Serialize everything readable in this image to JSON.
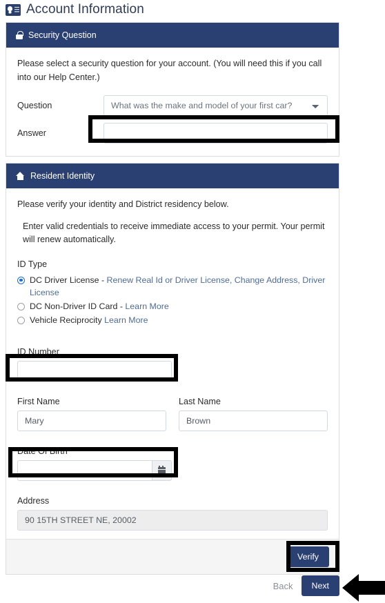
{
  "page": {
    "title": "Account Information",
    "title_icon": "id-card-icon"
  },
  "security_panel": {
    "icon": "lock-icon",
    "heading": "Security Question",
    "intro": "Please select a security question for your account. (You will need this if you call into our Help Center.)",
    "question_label": "Question",
    "question_value": "What was the make and model of your first car?",
    "question_options": [
      "What was the make and model of your first car?"
    ],
    "answer_label": "Answer",
    "answer_value": "",
    "answer_placeholder": ""
  },
  "identity_panel": {
    "icon": "home-icon",
    "heading": "Resident Identity",
    "intro": "Please verify your identity and District residency below.",
    "note": "Enter valid credentials to receive immediate access to your permit. Your permit will renew automatically.",
    "id_type_label": "ID Type",
    "id_type_options": [
      {
        "label": "DC Driver License",
        "separator": " - ",
        "link": "Renew Real Id or Driver License, Change Address, Driver License",
        "selected": true
      },
      {
        "label": "DC Non-Driver ID Card",
        "separator": " - ",
        "link": "Learn More",
        "selected": false
      },
      {
        "label": "Vehicle Reciprocity",
        "separator": " ",
        "link": "Learn More",
        "selected": false
      }
    ],
    "id_number_label": "ID Number",
    "id_number_value": "",
    "first_name_label": "First Name",
    "first_name_value": "Mary",
    "last_name_label": "Last Name",
    "last_name_value": "Brown",
    "dob_label": "Date Of Birth",
    "dob_value": "",
    "calendar_icon": "calendar-icon",
    "address_label": "Address",
    "address_value": "90 15TH STREET NE, 20002",
    "verify_label": "Verify"
  },
  "footer_nav": {
    "back_label": "Back",
    "next_label": "Next"
  },
  "colors": {
    "panel_header": "#2b4072",
    "title_text": "#2f3c58",
    "link": "#4e6c9b",
    "radio_accent": "#1c6fd6",
    "readonly_bg": "#ededed",
    "footer_bg": "#f5f5f5",
    "highlight": "#000000"
  }
}
